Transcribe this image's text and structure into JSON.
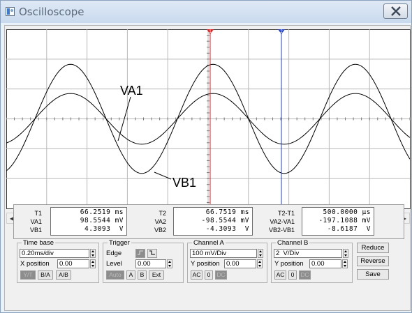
{
  "window": {
    "title": "Oscilloscope"
  },
  "screen": {
    "grid": {
      "rows": 6,
      "cols": 10
    },
    "traces": [
      {
        "name": "VA1",
        "amplitude_div": 1,
        "phase_deg": 0
      },
      {
        "name": "VB1",
        "amplitude_div": 2.15,
        "phase_deg": 0
      }
    ],
    "cursor1": {
      "label": "1",
      "color": "#e02020"
    },
    "cursor2": {
      "label": "2",
      "color": "#2040d0"
    }
  },
  "readout": {
    "t1": {
      "label": "T1",
      "value": "66.2519",
      "unit": "ms"
    },
    "va1": {
      "label": "VA1",
      "value": "98.5544",
      "unit": "mV"
    },
    "vb1": {
      "label": "VB1",
      "value": "4.3093",
      "unit": "V"
    },
    "t2": {
      "label": "T2",
      "value": "66.7519",
      "unit": "ms"
    },
    "va2": {
      "label": "VA2",
      "value": "-98.5544",
      "unit": "mV"
    },
    "vb2": {
      "label": "VB2",
      "value": "-4.3093",
      "unit": "V"
    },
    "dt": {
      "label": "T2-T1",
      "value": "500.0000",
      "unit": "µs"
    },
    "dva": {
      "label": "VA2-VA1",
      "value": "-197.1088",
      "unit": "mV"
    },
    "dvb": {
      "label": "VB2-VB1",
      "value": "-8.6187",
      "unit": "V"
    }
  },
  "timebase": {
    "title": "Time base",
    "scale": "0.20ms/div",
    "xpos_label": "X position",
    "xpos": "0.00",
    "modes": [
      "Y/T",
      "B/A",
      "A/B"
    ]
  },
  "trigger": {
    "title": "Trigger",
    "edge_label": "Edge",
    "level_label": "Level",
    "level": "0.00",
    "sources": [
      "Auto",
      "A",
      "B",
      "Ext"
    ]
  },
  "channel_a": {
    "title": "Channel A",
    "scale": "100 mV/Div",
    "ypos_label": "Y position",
    "ypos": "0.00",
    "coupling": [
      "AC",
      "0",
      "DC"
    ]
  },
  "channel_b": {
    "title": "Channel B",
    "scale": "2  V/Div",
    "ypos_label": "Y position",
    "ypos": "0.00",
    "coupling": [
      "AC",
      "0",
      "DC"
    ]
  },
  "actions": {
    "reduce": "Reduce",
    "reverse": "Reverse",
    "save": "Save"
  }
}
